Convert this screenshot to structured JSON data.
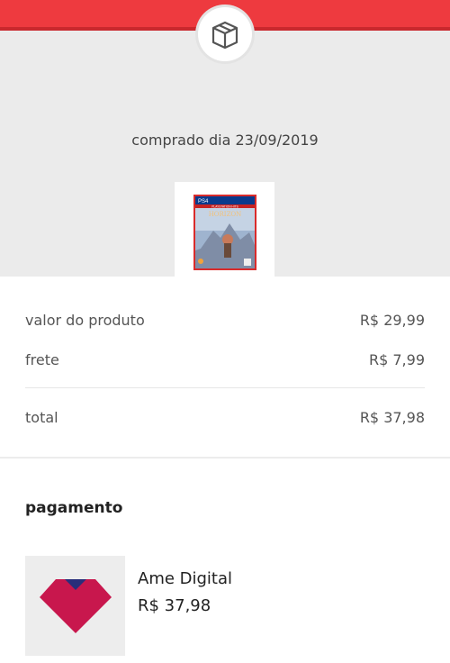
{
  "order": {
    "purchase_date": "comprado dia 23/09/2019",
    "product_image_icon": "ps4-game-cover"
  },
  "summary": {
    "product_label": "valor do produto",
    "product_value": "R$ 29,99",
    "shipping_label": "frete",
    "shipping_value": "R$ 7,99",
    "total_label": "total",
    "total_value": "R$ 37,98"
  },
  "payment": {
    "section_title": "pagamento",
    "method_name": "Ame Digital",
    "amount": "R$ 37,98",
    "logo_icon": "ame-digital-logo"
  },
  "colors": {
    "header_red": "#ee3a3f",
    "ame_magenta": "#c8174d",
    "ame_blue": "#2a2e7a"
  },
  "cover": {
    "platform": "PS4",
    "banner": "PLAYSTATION HITS",
    "title": "HORIZON"
  }
}
